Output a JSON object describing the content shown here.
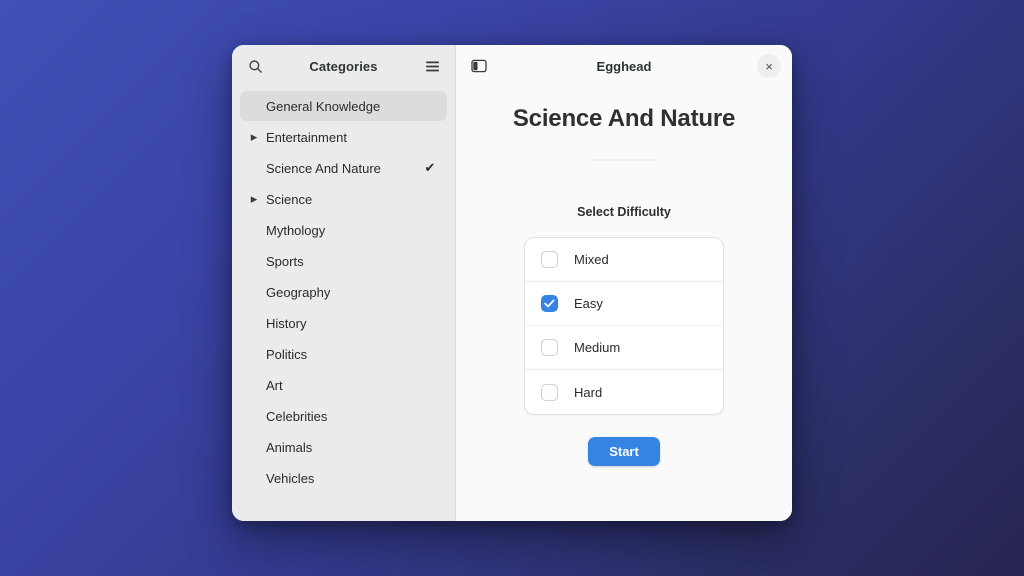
{
  "window": {
    "sidebar": {
      "search_icon": "search-icon",
      "title": "Categories",
      "menu_icon": "hamburger-menu-icon",
      "items": [
        {
          "label": "General Knowledge",
          "expandable": false,
          "selected": true,
          "checked": false
        },
        {
          "label": "Entertainment",
          "expandable": true,
          "selected": false,
          "checked": false
        },
        {
          "label": "Science And Nature",
          "expandable": false,
          "selected": false,
          "checked": true
        },
        {
          "label": "Science",
          "expandable": true,
          "selected": false,
          "checked": false
        },
        {
          "label": "Mythology",
          "expandable": false,
          "selected": false,
          "checked": false
        },
        {
          "label": "Sports",
          "expandable": false,
          "selected": false,
          "checked": false
        },
        {
          "label": "Geography",
          "expandable": false,
          "selected": false,
          "checked": false
        },
        {
          "label": "History",
          "expandable": false,
          "selected": false,
          "checked": false
        },
        {
          "label": "Politics",
          "expandable": false,
          "selected": false,
          "checked": false
        },
        {
          "label": "Art",
          "expandable": false,
          "selected": false,
          "checked": false
        },
        {
          "label": "Celebrities",
          "expandable": false,
          "selected": false,
          "checked": false
        },
        {
          "label": "Animals",
          "expandable": false,
          "selected": false,
          "checked": false
        },
        {
          "label": "Vehicles",
          "expandable": false,
          "selected": false,
          "checked": false
        }
      ]
    },
    "header": {
      "sidebar_toggle_icon": "sidebar-toggle-icon",
      "title": "Egghead",
      "close_label": "×"
    },
    "main": {
      "quiz_title": "Science And Nature",
      "difficulty_heading": "Select Difficulty",
      "difficulties": [
        {
          "label": "Mixed",
          "checked": false
        },
        {
          "label": "Easy",
          "checked": true
        },
        {
          "label": "Medium",
          "checked": false
        },
        {
          "label": "Hard",
          "checked": false
        }
      ],
      "start_label": "Start"
    }
  },
  "colors": {
    "accent": "#3584e4",
    "sidebar_bg": "#ebebeb",
    "content_bg": "#fafafa",
    "selected_row": "#dcdcdc",
    "desktop_gradient_start": "#4150b5",
    "desktop_gradient_end": "#272551"
  }
}
